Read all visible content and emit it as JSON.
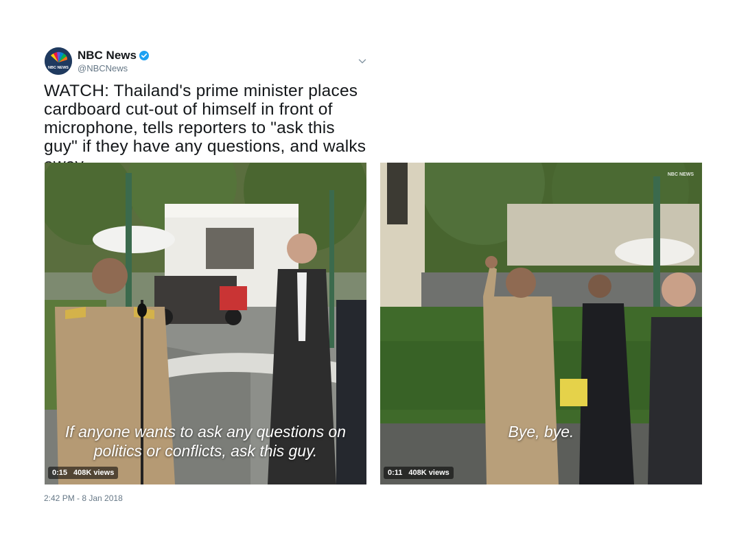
{
  "author": {
    "display_name": "NBC News",
    "handle": "@NBCNews",
    "verified": true,
    "logo_text": "NBC NEWS"
  },
  "tweet": {
    "text": "WATCH: Thailand's prime minister places cardboard cut-out of himself in front of microphone, tells reporters to \"ask this guy\" if they have any questions, and walks away.",
    "timestamp": "2:42 PM - 8 Jan 2018"
  },
  "videos": [
    {
      "caption_line1": "If anyone wants to ask any questions on",
      "caption_line2": "politics or conflicts, ask this guy.",
      "duration": "0:15",
      "views": "408K views"
    },
    {
      "caption_line1": "Bye, bye.",
      "caption_line2": "",
      "duration": "0:11",
      "views": "408K views",
      "watermark": "NBC NEWS"
    }
  ],
  "colors": {
    "verified": "#1da1f2",
    "text": "#14171a",
    "secondary_text": "#657786"
  }
}
